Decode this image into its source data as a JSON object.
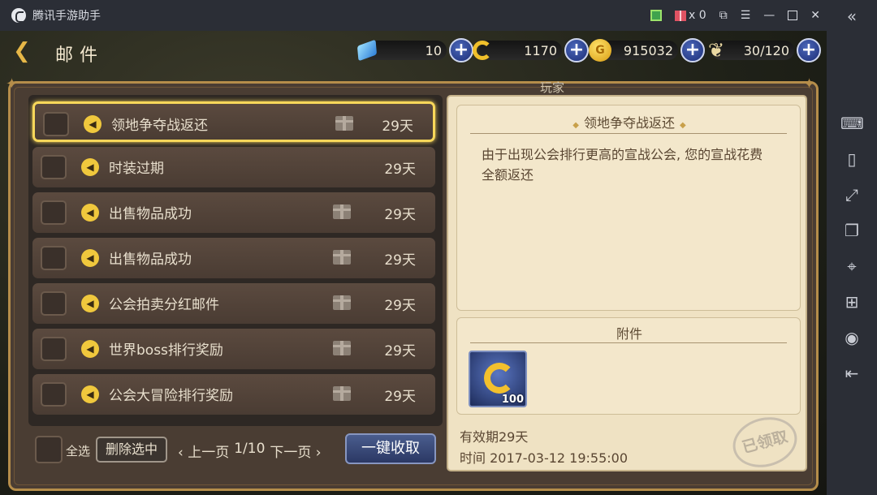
{
  "window": {
    "title": "腾讯手游助手",
    "gift_count": "x 0"
  },
  "header": {
    "title": "邮件"
  },
  "resources": [
    {
      "icon": "diamond-icon",
      "value": "10"
    },
    {
      "icon": "c-coin-icon",
      "value": "1170"
    },
    {
      "icon": "gold-coin-icon",
      "value": "915032"
    },
    {
      "icon": "stamina-wing-icon",
      "value": "30/120"
    }
  ],
  "panel": {
    "player_label": "玩家"
  },
  "mails": [
    {
      "title": "领地争夺战返还",
      "days": "29天",
      "has_gift": true,
      "selected": true
    },
    {
      "title": "时装过期",
      "days": "29天",
      "has_gift": false,
      "selected": false
    },
    {
      "title": "出售物品成功",
      "days": "29天",
      "has_gift": true,
      "selected": false
    },
    {
      "title": "出售物品成功",
      "days": "29天",
      "has_gift": true,
      "selected": false
    },
    {
      "title": "公会拍卖分红邮件",
      "days": "29天",
      "has_gift": true,
      "selected": false
    },
    {
      "title": "世界boss排行奖励",
      "days": "29天",
      "has_gift": true,
      "selected": false
    },
    {
      "title": "公会大冒险排行奖励",
      "days": "29天",
      "has_gift": true,
      "selected": false
    }
  ],
  "controls": {
    "select_all": "全选",
    "delete_selected": "删除选中",
    "prev_page": "上一页",
    "page": "1/10",
    "next_page": "下一页",
    "claim_all": "一键收取"
  },
  "detail": {
    "title": "领地争夺战返还",
    "body": "由于出现公会排行更高的宣战公会, 您的宣战花费全额返还",
    "attachment_title": "附件",
    "attachment_qty": "100",
    "expiry": "有效期29天",
    "time": "时间 2017-03-12 19:55:00",
    "stamp": "已领取"
  }
}
